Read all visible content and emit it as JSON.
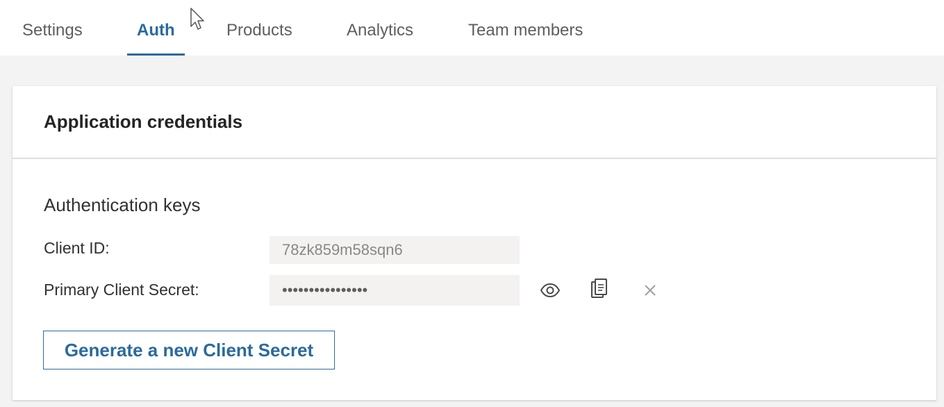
{
  "tabs": [
    {
      "label": "Settings",
      "active": false
    },
    {
      "label": "Auth",
      "active": true
    },
    {
      "label": "Products",
      "active": false
    },
    {
      "label": "Analytics",
      "active": false
    },
    {
      "label": "Team members",
      "active": false
    }
  ],
  "card": {
    "title": "Application credentials",
    "section_title": "Authentication keys",
    "client_id": {
      "label": "Client ID:",
      "value": "78zk859m58sqn6"
    },
    "client_secret": {
      "label": "Primary Client Secret:",
      "value": "••••••••••••••••",
      "actions": [
        "eye-icon",
        "copy-icon",
        "close-icon"
      ]
    },
    "generate_button": "Generate a new Client Secret"
  },
  "colors": {
    "accent": "#2b6a9e",
    "tabbar_bg": "#ffffff",
    "page_bg": "#f3f3f3",
    "field_bg": "#f3f2f1"
  }
}
